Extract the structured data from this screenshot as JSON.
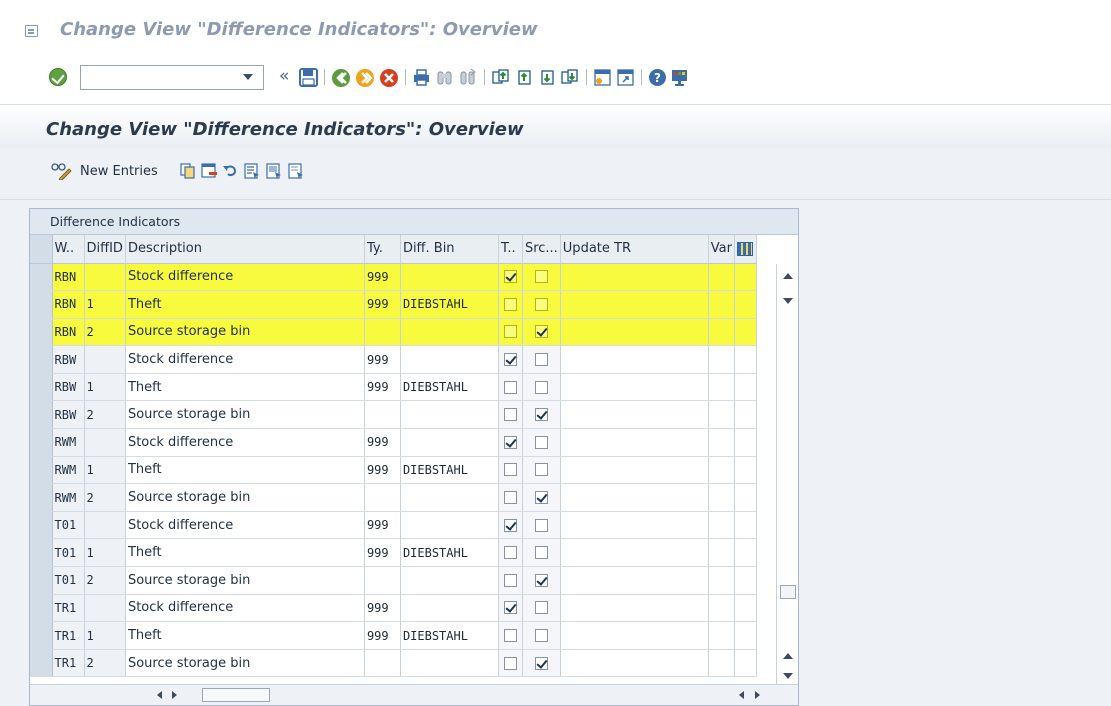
{
  "window": {
    "title": "Change View \"Difference Indicators\": Overview"
  },
  "toolbar": {
    "command_field_value": "",
    "icons": [
      "enter-icon",
      "collapse-icon",
      "save-icon",
      "back-icon",
      "exit-icon",
      "cancel-icon",
      "print-icon",
      "find-icon",
      "find-next-icon",
      "first-page-icon",
      "previous-page-icon",
      "next-page-icon",
      "last-page-icon",
      "create-session-icon",
      "shortcut-icon",
      "help-icon",
      "customize-layout-icon"
    ],
    "collapse_glyph": "«"
  },
  "screen": {
    "title": "Change View \"Difference Indicators\": Overview"
  },
  "app_toolbar": {
    "new_entries_label": "New Entries",
    "icons": [
      "display-change-icon",
      "copy-as-icon",
      "delete-icon",
      "undo-change-icon",
      "select-all-icon",
      "select-block-icon",
      "deselect-all-icon"
    ]
  },
  "table": {
    "caption": "Difference Indicators",
    "columns": [
      "W..",
      "DiffID",
      "Description",
      "Ty.",
      "Diff. Bin",
      "T..",
      "Src...",
      "Update TR",
      "Var"
    ],
    "rows": [
      {
        "wh": "RBN",
        "diffid": "",
        "desc": "Stock difference",
        "ty": "999",
        "bin": "",
        "t": true,
        "src": false,
        "highlight": true
      },
      {
        "wh": "RBN",
        "diffid": "1",
        "desc": "Theft",
        "ty": "999",
        "bin": "DIEBSTAHL",
        "t": false,
        "src": false,
        "highlight": true
      },
      {
        "wh": "RBN",
        "diffid": "2",
        "desc": "Source storage bin",
        "ty": "",
        "bin": "",
        "t": false,
        "src": true,
        "highlight": true
      },
      {
        "wh": "RBW",
        "diffid": "",
        "desc": "Stock difference",
        "ty": "999",
        "bin": "",
        "t": true,
        "src": false,
        "highlight": false
      },
      {
        "wh": "RBW",
        "diffid": "1",
        "desc": "Theft",
        "ty": "999",
        "bin": "DIEBSTAHL",
        "t": false,
        "src": false,
        "highlight": false
      },
      {
        "wh": "RBW",
        "diffid": "2",
        "desc": "Source storage bin",
        "ty": "",
        "bin": "",
        "t": false,
        "src": true,
        "highlight": false
      },
      {
        "wh": "RWM",
        "diffid": "",
        "desc": "Stock difference",
        "ty": "999",
        "bin": "",
        "t": true,
        "src": false,
        "highlight": false
      },
      {
        "wh": "RWM",
        "diffid": "1",
        "desc": "Theft",
        "ty": "999",
        "bin": "DIEBSTAHL",
        "t": false,
        "src": false,
        "highlight": false
      },
      {
        "wh": "RWM",
        "diffid": "2",
        "desc": "Source storage bin",
        "ty": "",
        "bin": "",
        "t": false,
        "src": true,
        "highlight": false
      },
      {
        "wh": "T01",
        "diffid": "",
        "desc": "Stock difference",
        "ty": "999",
        "bin": "",
        "t": true,
        "src": false,
        "highlight": false
      },
      {
        "wh": "T01",
        "diffid": "1",
        "desc": "Theft",
        "ty": "999",
        "bin": "DIEBSTAHL",
        "t": false,
        "src": false,
        "highlight": false
      },
      {
        "wh": "T01",
        "diffid": "2",
        "desc": "Source storage bin",
        "ty": "",
        "bin": "",
        "t": false,
        "src": true,
        "highlight": false
      },
      {
        "wh": "TR1",
        "diffid": "",
        "desc": "Stock difference",
        "ty": "999",
        "bin": "",
        "t": true,
        "src": false,
        "highlight": false
      },
      {
        "wh": "TR1",
        "diffid": "1",
        "desc": "Theft",
        "ty": "999",
        "bin": "DIEBSTAHL",
        "t": false,
        "src": false,
        "highlight": false
      },
      {
        "wh": "TR1",
        "diffid": "2",
        "desc": "Source storage bin",
        "ty": "",
        "bin": "",
        "t": false,
        "src": true,
        "highlight": false
      }
    ]
  },
  "colors": {
    "highlight": "#f8fb3d",
    "title_muted": "#8c9bb0",
    "header_band": "#e9eef3"
  }
}
